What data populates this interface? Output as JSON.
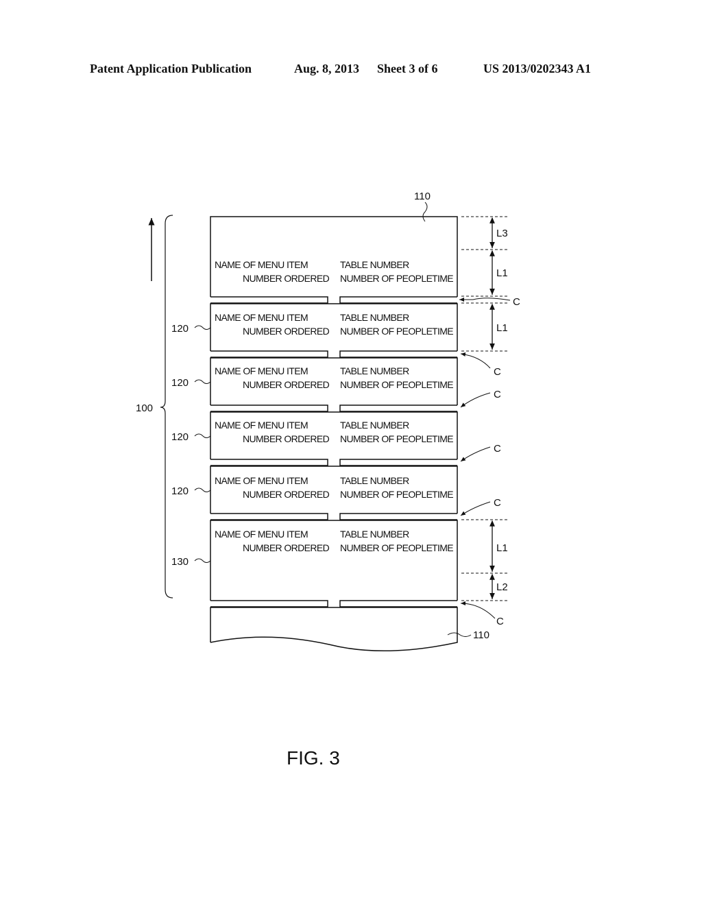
{
  "header": {
    "publication": "Patent Application Publication",
    "date": "Aug. 8, 2013",
    "sheet": "Sheet 3 of 6",
    "number": "US 2013/0202343 A1"
  },
  "figure": {
    "caption": "FIG. 3",
    "ref_tape": "110",
    "ref_tape_bottom": "110",
    "ref_group": "100",
    "slip_fields": {
      "menu_item": "NAME OF MENU ITEM",
      "number_ordered": "NUMBER ORDERED",
      "table_number": "TABLE NUMBER",
      "number_of_people": "NUMBER OF PEOPLE",
      "time": "TIME"
    },
    "slips": [
      {
        "ref": ""
      },
      {
        "ref": "120"
      },
      {
        "ref": "120"
      },
      {
        "ref": "120"
      },
      {
        "ref": "120"
      },
      {
        "ref": "130"
      }
    ],
    "dimensions": {
      "l1": "L1",
      "l2": "L2",
      "l3": "L3"
    },
    "cut_label": "C"
  }
}
